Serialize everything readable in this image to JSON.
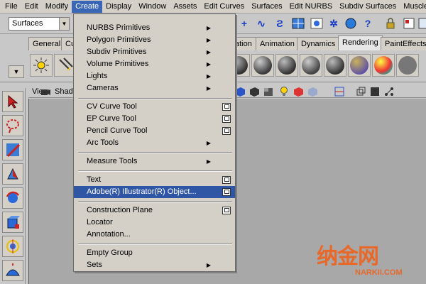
{
  "menubar": {
    "items": [
      "File",
      "Edit",
      "Modify",
      "Create",
      "Display",
      "Window",
      "Assets",
      "Edit Curves",
      "Surfaces",
      "Edit NURBS",
      "Subdiv Surfaces",
      "Muscle"
    ],
    "active": "Create"
  },
  "statusline": {
    "mode": "Surfaces"
  },
  "shelf_tabs": {
    "items": [
      "General",
      "Cu",
      "ation",
      "Animation",
      "Dynamics",
      "Rendering",
      "PaintEffects"
    ],
    "active": "Rendering"
  },
  "viewport": {
    "menus": [
      "View",
      "Shad"
    ]
  },
  "create_menu": {
    "items": [
      {
        "label": "NURBS Primitives",
        "submenu": true
      },
      {
        "label": "Polygon Primitives",
        "submenu": true
      },
      {
        "label": "Subdiv Primitives",
        "submenu": true
      },
      {
        "label": "Volume Primitives",
        "submenu": true
      },
      {
        "label": "Lights",
        "submenu": true
      },
      {
        "label": "Cameras",
        "submenu": true
      },
      {
        "label": "CV Curve Tool",
        "option_box": true
      },
      {
        "label": "EP Curve Tool",
        "option_box": true
      },
      {
        "label": "Pencil Curve Tool",
        "option_box": true
      },
      {
        "label": "Arc Tools",
        "submenu": true
      },
      {
        "label": "Measure Tools",
        "submenu": true
      },
      {
        "label": "Text",
        "option_box": true
      },
      {
        "label": "Adobe(R) Illustrator(R) Object...",
        "option_box": true,
        "highlighted": true
      },
      {
        "label": "Construction Plane",
        "option_box": true
      },
      {
        "label": "Locator"
      },
      {
        "label": "Annotation..."
      },
      {
        "label": "Empty Group"
      },
      {
        "label": "Sets",
        "submenu": true
      }
    ],
    "submenu_glyph": "▶"
  },
  "watermark": {
    "text": "纳金网",
    "url": "NARKII.COM"
  },
  "colors": {
    "menu_highlight": "#2f55a5",
    "watermark": "#e8682a"
  }
}
